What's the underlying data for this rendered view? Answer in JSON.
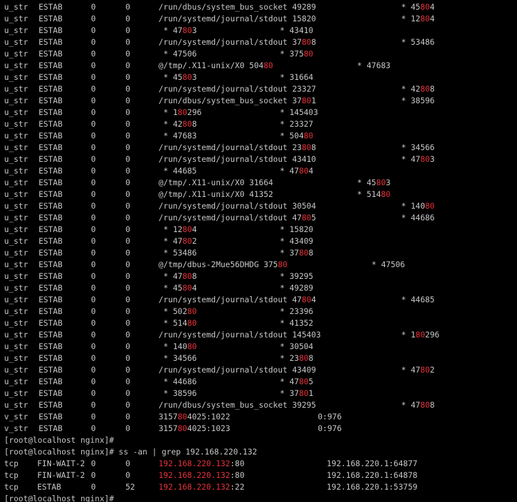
{
  "terminal": {
    "socket_rows": [
      [
        "u_str",
        "ESTAB",
        "0",
        "0",
        "/run/dbus/system_bus_socket 49289",
        "* 45804"
      ],
      [
        "u_str",
        "ESTAB",
        "0",
        "0",
        "/run/systemd/journal/stdout 15820",
        "* 12804"
      ],
      [
        "u_str",
        "ESTAB",
        "0",
        "0",
        "* 47803",
        "* 43410"
      ],
      [
        "u_str",
        "ESTAB",
        "0",
        "0",
        "/run/systemd/journal/stdout 37808",
        "* 53486"
      ],
      [
        "u_str",
        "ESTAB",
        "0",
        "0",
        "* 47506",
        "* 37580"
      ],
      [
        "u_str",
        "ESTAB",
        "0",
        "0",
        "@/tmp/.X11-unix/X0 50480",
        "* 47683"
      ],
      [
        "u_str",
        "ESTAB",
        "0",
        "0",
        "* 45803",
        "* 31664"
      ],
      [
        "u_str",
        "ESTAB",
        "0",
        "0",
        "/run/systemd/journal/stdout 23327",
        "* 42808"
      ],
      [
        "u_str",
        "ESTAB",
        "0",
        "0",
        "/run/dbus/system_bus_socket 37801",
        "* 38596"
      ],
      [
        "u_str",
        "ESTAB",
        "0",
        "0",
        "* 180296",
        "* 145403"
      ],
      [
        "u_str",
        "ESTAB",
        "0",
        "0",
        "* 42808",
        "* 23327"
      ],
      [
        "u_str",
        "ESTAB",
        "0",
        "0",
        "* 47683",
        "* 50480"
      ],
      [
        "u_str",
        "ESTAB",
        "0",
        "0",
        "/run/systemd/journal/stdout 23808",
        "* 34566"
      ],
      [
        "u_str",
        "ESTAB",
        "0",
        "0",
        "/run/systemd/journal/stdout 43410",
        "* 47803"
      ],
      [
        "u_str",
        "ESTAB",
        "0",
        "0",
        "* 44685",
        "* 47804"
      ],
      [
        "u_str",
        "ESTAB",
        "0",
        "0",
        "@/tmp/.X11-unix/X0 31664",
        "* 45803"
      ],
      [
        "u_str",
        "ESTAB",
        "0",
        "0",
        "@/tmp/.X11-unix/X0 41352",
        "* 51480"
      ],
      [
        "u_str",
        "ESTAB",
        "0",
        "0",
        "/run/systemd/journal/stdout 30504",
        "* 14080"
      ],
      [
        "u_str",
        "ESTAB",
        "0",
        "0",
        "/run/systemd/journal/stdout 47805",
        "* 44686"
      ],
      [
        "u_str",
        "ESTAB",
        "0",
        "0",
        "* 12804",
        "* 15820"
      ],
      [
        "u_str",
        "ESTAB",
        "0",
        "0",
        "* 47802",
        "* 43409"
      ],
      [
        "u_str",
        "ESTAB",
        "0",
        "0",
        "* 53486",
        "* 37808"
      ],
      [
        "u_str",
        "ESTAB",
        "0",
        "0",
        "@/tmp/dbus-2Mue56DHDG 37580",
        "* 47506"
      ],
      [
        "u_str",
        "ESTAB",
        "0",
        "0",
        "* 47808",
        "* 39295"
      ],
      [
        "u_str",
        "ESTAB",
        "0",
        "0",
        "* 45804",
        "* 49289"
      ],
      [
        "u_str",
        "ESTAB",
        "0",
        "0",
        "/run/systemd/journal/stdout 47804",
        "* 44685"
      ],
      [
        "u_str",
        "ESTAB",
        "0",
        "0",
        "* 50280",
        "* 23396"
      ],
      [
        "u_str",
        "ESTAB",
        "0",
        "0",
        "* 51480",
        "* 41352"
      ],
      [
        "u_str",
        "ESTAB",
        "0",
        "0",
        "/run/systemd/journal/stdout 145403",
        "* 180296"
      ],
      [
        "u_str",
        "ESTAB",
        "0",
        "0",
        "* 14080",
        "* 30504"
      ],
      [
        "u_str",
        "ESTAB",
        "0",
        "0",
        "* 34566",
        "* 23808"
      ],
      [
        "u_str",
        "ESTAB",
        "0",
        "0",
        "/run/systemd/journal/stdout 43409",
        "* 47802"
      ],
      [
        "u_str",
        "ESTAB",
        "0",
        "0",
        "* 44686",
        "* 47805"
      ],
      [
        "u_str",
        "ESTAB",
        "0",
        "0",
        "* 38596",
        "* 37801"
      ],
      [
        "u_str",
        "ESTAB",
        "0",
        "0",
        "/run/dbus/system_bus_socket 39295",
        "* 47808"
      ],
      [
        "v_str",
        "ESTAB",
        "0",
        "0",
        "3157804025:1022",
        "0:976"
      ],
      [
        "v_str",
        "ESTAB",
        "0",
        "0",
        "3157804025:1023",
        "0:976"
      ]
    ],
    "prompt_after_list": "[root@localhost nginx]#",
    "prompt_with_command": "[root@localhost nginx]# ss -an | grep 192.168.220.132",
    "tcp_rows": [
      [
        "tcp",
        "FIN-WAIT-2",
        "0",
        "0",
        "192.168.220.132:80",
        "192.168.220.1:64877"
      ],
      [
        "tcp",
        "FIN-WAIT-2",
        "0",
        "0",
        "192.168.220.132:80",
        "192.168.220.1:64878"
      ],
      [
        "tcp",
        "ESTAB",
        "0",
        "52",
        "192.168.220.132:22",
        "192.168.220.1:53759"
      ]
    ],
    "final_prompt": "[root@localhost nginx]#",
    "highlight_terms": [
      "80",
      "192.168.220.132"
    ],
    "colors": {
      "background": "#000000",
      "text": "#c8c8c8",
      "highlight": "#e8323a"
    }
  }
}
